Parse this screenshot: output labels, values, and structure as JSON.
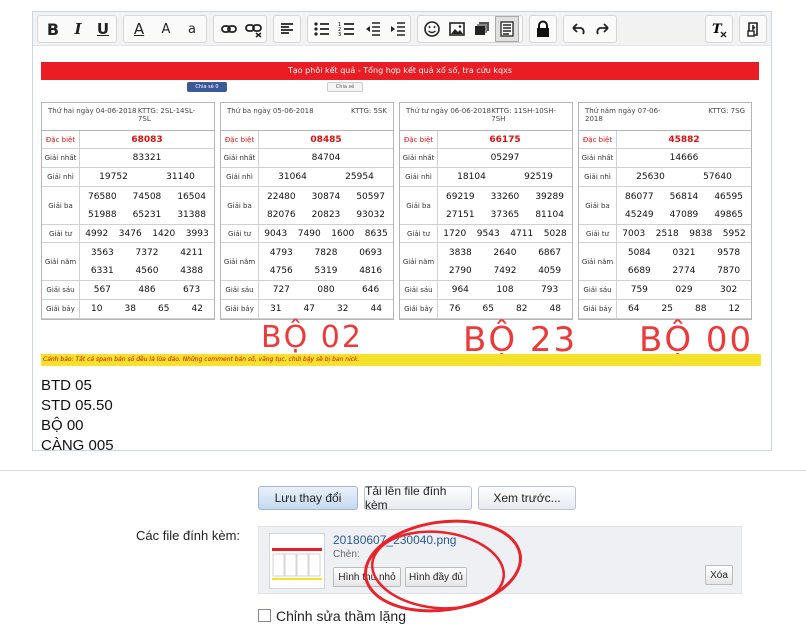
{
  "toolbar": {
    "buttons": [
      "bold",
      "italic",
      "underline",
      "font-color",
      "font-size",
      "font-family",
      "link",
      "unlink",
      "align",
      "bullet-list",
      "numbered-list",
      "outdent",
      "indent",
      "smilies",
      "image",
      "media",
      "code",
      "lock",
      "undo",
      "redo",
      "remove-format",
      "bb-code"
    ],
    "bold_label": "B",
    "italic_label": "I",
    "underline_label": "U",
    "font_color_label": "A",
    "font_size_label": "A",
    "font_family_label": "a"
  },
  "image": {
    "banner": "Tạo phôi kết quả - Tổng hợp kết quả xổ số, tra cứu kqxs",
    "share_fb": "Chia sẻ 0",
    "share_g": "Chia sẻ",
    "warning": "Cảnh báo: Tất cả spam bán số đều là lừa đảo. Những comment bán số, văng tục, chửi bậy sẽ bị ban nick.",
    "handwriting": [
      "BỘ 02",
      "BỘ 23",
      "BỘ 00"
    ],
    "tables": [
      {
        "date": "Thứ hai ngày 04-06-2018",
        "code": "KTTG: 2SL-14SL-7SL",
        "rows": [
          {
            "label": "Đặc biệt",
            "nums": [
              "68083"
            ],
            "red": true
          },
          {
            "label": "Giải nhất",
            "nums": [
              "83321"
            ]
          },
          {
            "label": "Giải nhì",
            "nums": [
              "19752",
              "31140"
            ]
          },
          {
            "label": "Giải ba",
            "nums": [
              "76580",
              "74508",
              "16504",
              "51988",
              "65231",
              "31388"
            ]
          },
          {
            "label": "Giải tư",
            "nums": [
              "4992",
              "3476",
              "1420",
              "3993"
            ]
          },
          {
            "label": "Giải năm",
            "nums": [
              "3563",
              "7372",
              "4211",
              "6331",
              "4560",
              "4388"
            ]
          },
          {
            "label": "Giải sáu",
            "nums": [
              "567",
              "486",
              "673"
            ]
          },
          {
            "label": "Giải bảy",
            "nums": [
              "10",
              "38",
              "65",
              "42"
            ]
          }
        ]
      },
      {
        "date": "Thứ ba ngày 05-06-2018",
        "code": "KTTG: 5SK",
        "rows": [
          {
            "label": "Đặc biệt",
            "nums": [
              "08485"
            ],
            "red": true
          },
          {
            "label": "Giải nhất",
            "nums": [
              "84704"
            ]
          },
          {
            "label": "Giải nhì",
            "nums": [
              "31064",
              "25954"
            ]
          },
          {
            "label": "Giải ba",
            "nums": [
              "22480",
              "30874",
              "50597",
              "82076",
              "20823",
              "93032"
            ]
          },
          {
            "label": "Giải tư",
            "nums": [
              "9043",
              "7490",
              "1600",
              "8635"
            ]
          },
          {
            "label": "Giải năm",
            "nums": [
              "4793",
              "7828",
              "0693",
              "4756",
              "5319",
              "4816"
            ]
          },
          {
            "label": "Giải sáu",
            "nums": [
              "727",
              "080",
              "646"
            ]
          },
          {
            "label": "Giải bảy",
            "nums": [
              "31",
              "47",
              "32",
              "44"
            ]
          }
        ]
      },
      {
        "date": "Thứ tư ngày 06-06-2018",
        "code": "KTTG: 11SH-10SH-7SH",
        "rows": [
          {
            "label": "Đặc biệt",
            "nums": [
              "66175"
            ],
            "red": true
          },
          {
            "label": "Giải nhất",
            "nums": [
              "05297"
            ]
          },
          {
            "label": "Giải nhì",
            "nums": [
              "18104",
              "92519"
            ]
          },
          {
            "label": "Giải ba",
            "nums": [
              "69219",
              "33260",
              "39289",
              "27151",
              "37365",
              "81104"
            ]
          },
          {
            "label": "Giải tư",
            "nums": [
              "1720",
              "9543",
              "4711",
              "5028"
            ]
          },
          {
            "label": "Giải năm",
            "nums": [
              "3838",
              "2640",
              "6867",
              "2790",
              "7492",
              "4059"
            ]
          },
          {
            "label": "Giải sáu",
            "nums": [
              "964",
              "108",
              "793"
            ]
          },
          {
            "label": "Giải bảy",
            "nums": [
              "76",
              "65",
              "82",
              "48"
            ]
          }
        ]
      },
      {
        "date": "Thứ năm ngày 07-06-2018",
        "code": "KTTG: 7SG",
        "rows": [
          {
            "label": "Đặc biệt",
            "nums": [
              "45882"
            ],
            "red": true
          },
          {
            "label": "Giải nhất",
            "nums": [
              "14666"
            ]
          },
          {
            "label": "Giải nhì",
            "nums": [
              "25630",
              "57640"
            ]
          },
          {
            "label": "Giải ba",
            "nums": [
              "86077",
              "56814",
              "46595",
              "45249",
              "47089",
              "49865"
            ]
          },
          {
            "label": "Giải tư",
            "nums": [
              "7003",
              "2518",
              "9838",
              "5952"
            ]
          },
          {
            "label": "Giải năm",
            "nums": [
              "5084",
              "0321",
              "9578",
              "6689",
              "2774",
              "7870"
            ]
          },
          {
            "label": "Giải sáu",
            "nums": [
              "759",
              "029",
              "302"
            ]
          },
          {
            "label": "Giải bảy",
            "nums": [
              "64",
              "25",
              "88",
              "12"
            ]
          }
        ]
      }
    ]
  },
  "editor_text": [
    "BTD 05",
    "STD 05.50",
    "BỘ 00",
    "CÀNG 005"
  ],
  "actions": {
    "save": "Lưu thay đổi",
    "upload": "Tải lên file đính kèm",
    "preview": "Xem trước..."
  },
  "attachments": {
    "label": "Các file đính kèm:",
    "filename": "20180607_230040.png",
    "insert_label": "Chèn:",
    "thumb_btn": "Hình thu nhỏ",
    "full_btn": "Hình đầy đủ",
    "delete_btn": "Xóa"
  },
  "silent_edit": "Chỉnh sửa thầm lặng"
}
